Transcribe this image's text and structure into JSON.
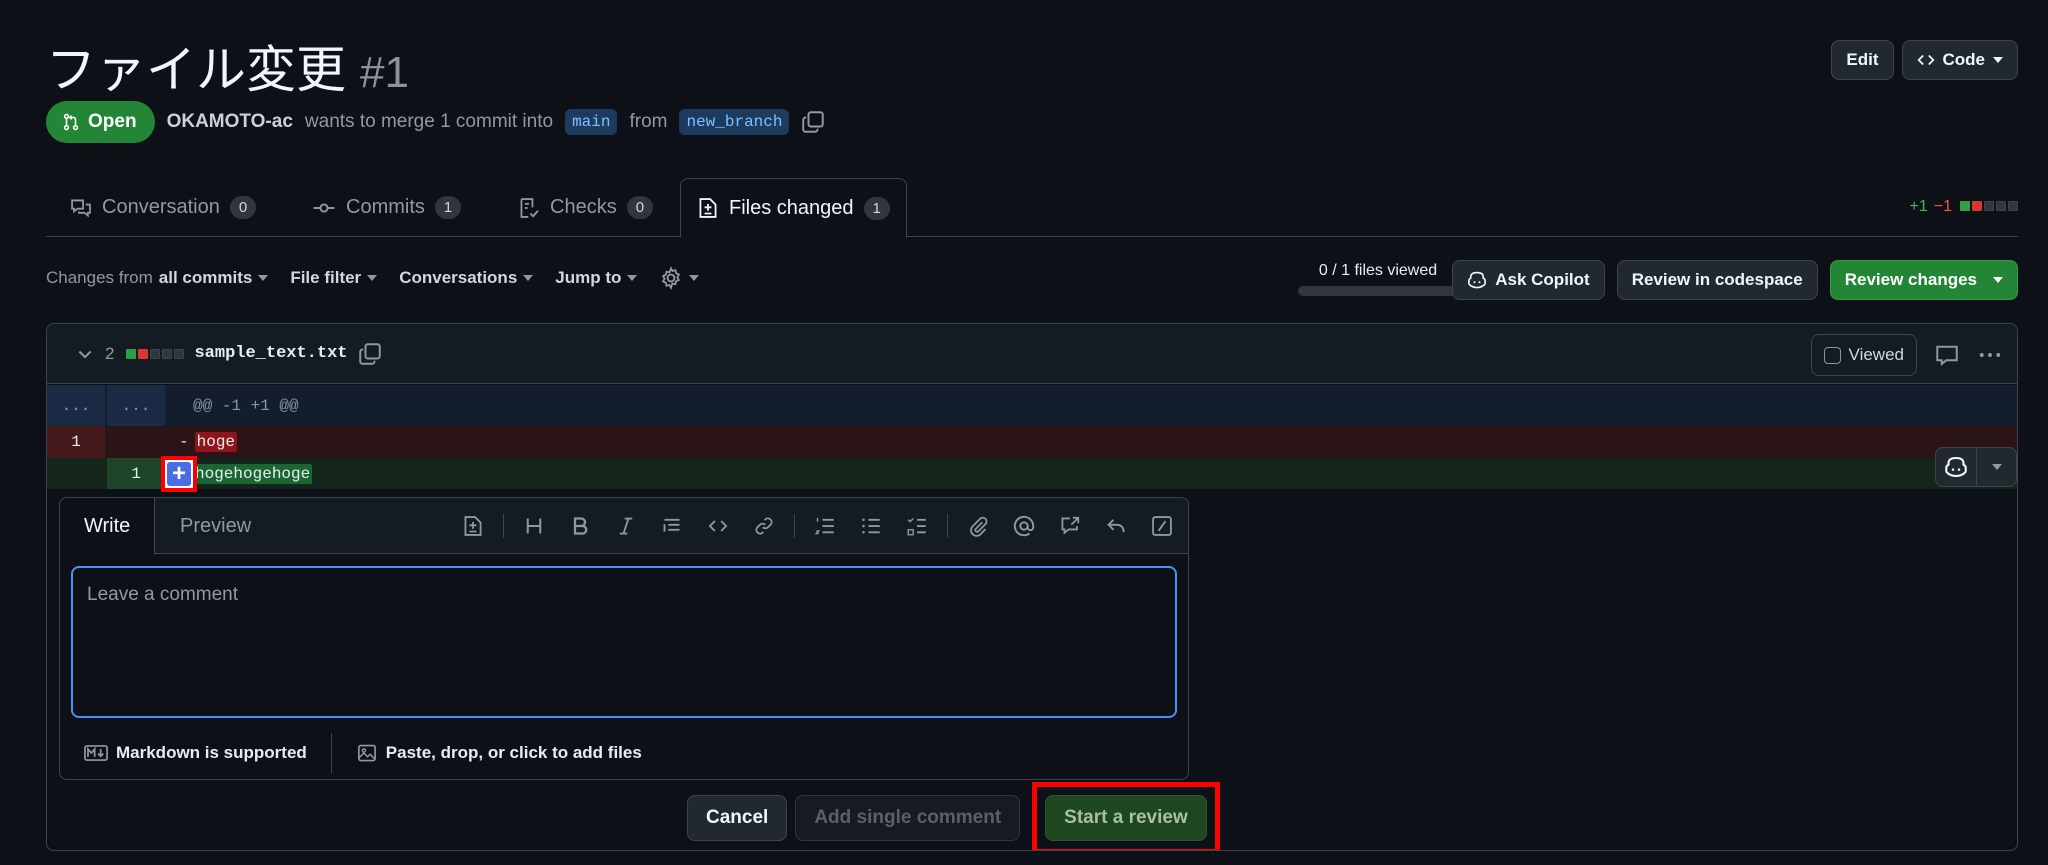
{
  "header": {
    "title": "ファイル変更",
    "pr_number": "#1",
    "edit_label": "Edit",
    "code_label": "Code"
  },
  "meta": {
    "state": "Open",
    "author": "OKAMOTO-ac",
    "merge_text": "wants to merge 1 commit into",
    "base_branch": "main",
    "from_text": "from",
    "head_branch": "new_branch"
  },
  "tabs": [
    {
      "label": "Conversation",
      "count": "0"
    },
    {
      "label": "Commits",
      "count": "1"
    },
    {
      "label": "Checks",
      "count": "0"
    },
    {
      "label": "Files changed",
      "count": "1"
    }
  ],
  "diffstat": {
    "additions": "+1",
    "deletions": "−1"
  },
  "toolbar": {
    "changes_from": "Changes from",
    "all_commits": "all commits",
    "file_filter": "File filter",
    "conversations": "Conversations",
    "jump_to": "Jump to",
    "files_viewed": "0 / 1 files viewed",
    "files_viewed_fraction": 0,
    "ask_copilot": "Ask Copilot",
    "review_codespace": "Review in codespace",
    "review_changes": "Review changes"
  },
  "file": {
    "changes": "2",
    "name": "sample_text.txt",
    "viewed_label": "Viewed",
    "hunk_left": "...",
    "hunk_right": "...",
    "hunk_header": "@@ -1 +1 @@",
    "del_line_num": "1",
    "del_marker": "-",
    "del_text": "hoge",
    "add_line_num": "1",
    "add_text": "hogehogehoge"
  },
  "editor": {
    "write_tab": "Write",
    "preview_tab": "Preview",
    "placeholder": "Leave a comment",
    "markdown_note": "Markdown is supported",
    "attach_note": "Paste, drop, or click to add files"
  },
  "actions": {
    "cancel": "Cancel",
    "add_single": "Add single comment",
    "start_review": "Start a review"
  },
  "colors": {
    "background": "#0d1117",
    "green": "#238636",
    "accent_blue": "#4493f8",
    "highlight_red": "#ff0000"
  }
}
